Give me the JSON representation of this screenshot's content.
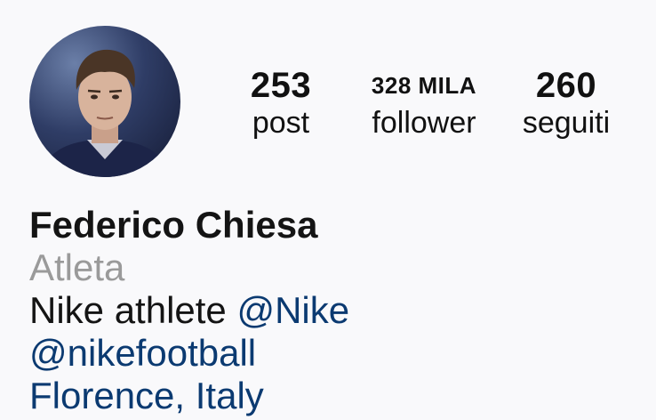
{
  "profile": {
    "stats": {
      "posts": {
        "value": "253",
        "label": "post"
      },
      "followers": {
        "value": "328 MILA",
        "label": "follower"
      },
      "following": {
        "value": "260",
        "label": "seguiti"
      }
    },
    "name": "Federico Chiesa",
    "category": "Atleta",
    "bio": {
      "line1_text": "Nike athlete ",
      "line1_mention": "@Nike",
      "line2_mention": "@nikefootball",
      "line3_text": "Florence, Italy"
    }
  },
  "colors": {
    "background": "#f9f9fb",
    "text": "#141414",
    "muted": "#9a9a9a",
    "link": "#0b3a71"
  }
}
